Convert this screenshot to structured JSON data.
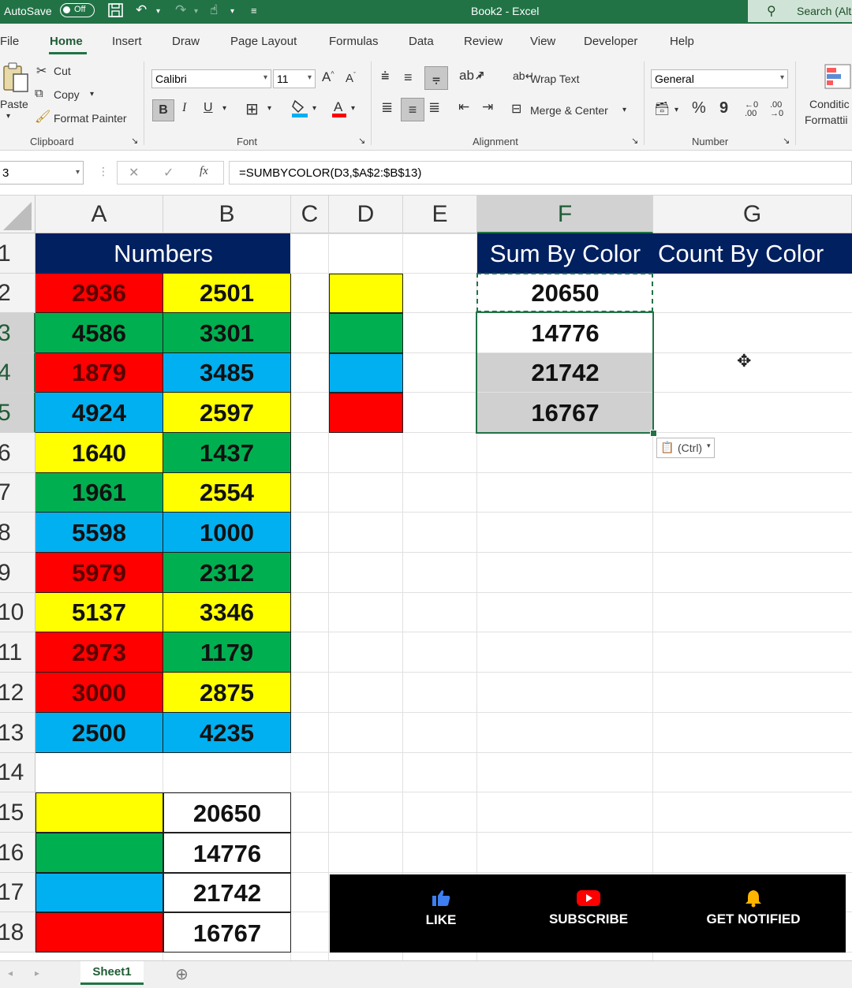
{
  "titlebar": {
    "autosave_label": "AutoSave",
    "autosave_state": "Off",
    "doc_title": "Book2  -  Excel",
    "search_placeholder": "Search (Alt"
  },
  "ribbon_tabs": [
    "File",
    "Home",
    "Insert",
    "Draw",
    "Page Layout",
    "Formulas",
    "Data",
    "Review",
    "View",
    "Developer",
    "Help"
  ],
  "ribbon": {
    "clipboard": {
      "paste": "Paste",
      "cut": "Cut",
      "copy": "Copy",
      "format_painter": "Format Painter",
      "group": "Clipboard"
    },
    "font": {
      "name": "Calibri",
      "size": "11",
      "bold": "B",
      "italic": "I",
      "underline": "U",
      "group": "Font"
    },
    "alignment": {
      "wrap": "Wrap Text",
      "merge": "Merge & Center",
      "group": "Alignment"
    },
    "number": {
      "format": "General",
      "percent": "%",
      "comma": "9",
      "group": "Number"
    },
    "styles": {
      "cond_line1": "Conditic",
      "cond_line2": "Formattii"
    }
  },
  "formula_bar": {
    "name_box": "3",
    "formula": "=SUMBYCOLOR(D3,$A$2:$B$13)",
    "fx": "fx"
  },
  "columns": [
    "A",
    "B",
    "C",
    "D",
    "E",
    "F",
    "G"
  ],
  "rows": [
    "1",
    "2",
    "3",
    "4",
    "5",
    "6",
    "7",
    "8",
    "9",
    "10",
    "11",
    "12",
    "13",
    "14",
    "15",
    "16",
    "17",
    "18"
  ],
  "colors": {
    "red": "#ff0000",
    "yellow": "#ffff00",
    "green": "#00b050",
    "blue": "#00b0f0",
    "navy": "#002060",
    "selected_gray": "#d0d0d0",
    "excel_green": "#217346"
  },
  "header_numbers": "Numbers",
  "header_sum": "Sum By Color",
  "header_count": "Count By Color",
  "data_rows": [
    {
      "a": "2936",
      "a_color": "red",
      "b": "2501",
      "b_color": "yellow"
    },
    {
      "a": "4586",
      "a_color": "green",
      "b": "3301",
      "b_color": "green"
    },
    {
      "a": "1879",
      "a_color": "red",
      "b": "3485",
      "b_color": "blue"
    },
    {
      "a": "4924",
      "a_color": "blue",
      "b": "2597",
      "b_color": "yellow"
    },
    {
      "a": "1640",
      "a_color": "yellow",
      "b": "1437",
      "b_color": "green"
    },
    {
      "a": "1961",
      "a_color": "green",
      "b": "2554",
      "b_color": "yellow"
    },
    {
      "a": "5598",
      "a_color": "blue",
      "b": "1000",
      "b_color": "blue"
    },
    {
      "a": "5979",
      "a_color": "red",
      "b": "2312",
      "b_color": "green"
    },
    {
      "a": "5137",
      "a_color": "yellow",
      "b": "3346",
      "b_color": "yellow"
    },
    {
      "a": "2973",
      "a_color": "red",
      "b": "1179",
      "b_color": "green"
    },
    {
      "a": "3000",
      "a_color": "red",
      "b": "2875",
      "b_color": "yellow"
    },
    {
      "a": "2500",
      "a_color": "blue",
      "b": "4235",
      "b_color": "blue"
    }
  ],
  "color_keys": [
    "yellow",
    "green",
    "blue",
    "red"
  ],
  "sum_results": [
    "20650",
    "14776",
    "21742",
    "16767"
  ],
  "summary_rows": [
    {
      "color": "yellow",
      "value": "20650"
    },
    {
      "color": "green",
      "value": "14776"
    },
    {
      "color": "blue",
      "value": "21742"
    },
    {
      "color": "red",
      "value": "16767"
    }
  ],
  "paste_options": "(Ctrl)",
  "sheet_tab": "Sheet1",
  "promo": {
    "like": "LIKE",
    "subscribe": "SUBSCRIBE",
    "notified": "GET NOTIFIED"
  }
}
